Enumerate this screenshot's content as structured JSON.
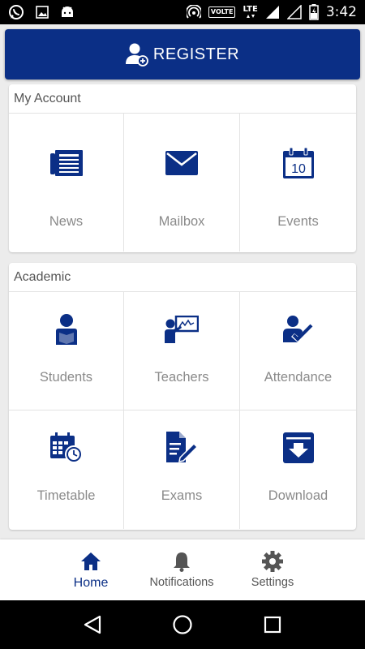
{
  "status_bar": {
    "time": "3:42",
    "network_badge": "VOLTE",
    "network_type": "LTE",
    "icons": [
      "whatsapp-icon",
      "image-icon",
      "android-icon",
      "hotspot-icon",
      "signal-icon",
      "battery-charging-icon"
    ]
  },
  "register": {
    "label": "REGISTER",
    "icon": "add-user-icon"
  },
  "my_account": {
    "title": "My Account",
    "items": [
      {
        "label": "News",
        "icon": "newspaper-icon"
      },
      {
        "label": "Mailbox",
        "icon": "envelope-icon"
      },
      {
        "label": "Events",
        "icon": "calendar-icon",
        "date_number": "10"
      }
    ]
  },
  "academic": {
    "title": "Academic",
    "items": [
      {
        "label": "Students",
        "icon": "student-icon"
      },
      {
        "label": "Teachers",
        "icon": "teacher-icon"
      },
      {
        "label": "Attendance",
        "icon": "attendance-icon"
      },
      {
        "label": "Timetable",
        "icon": "timetable-icon"
      },
      {
        "label": "Exams",
        "icon": "exam-icon"
      },
      {
        "label": "Download",
        "icon": "download-icon"
      }
    ]
  },
  "bottom_nav": {
    "items": [
      {
        "label": "Home",
        "icon": "home-icon",
        "active": true
      },
      {
        "label": "Notifications",
        "icon": "bell-icon",
        "active": false
      },
      {
        "label": "Settings",
        "icon": "gear-icon",
        "active": false
      }
    ]
  },
  "colors": {
    "primary": "#0b2f86",
    "background": "#ececec",
    "label_gray": "#8a8a8a"
  }
}
